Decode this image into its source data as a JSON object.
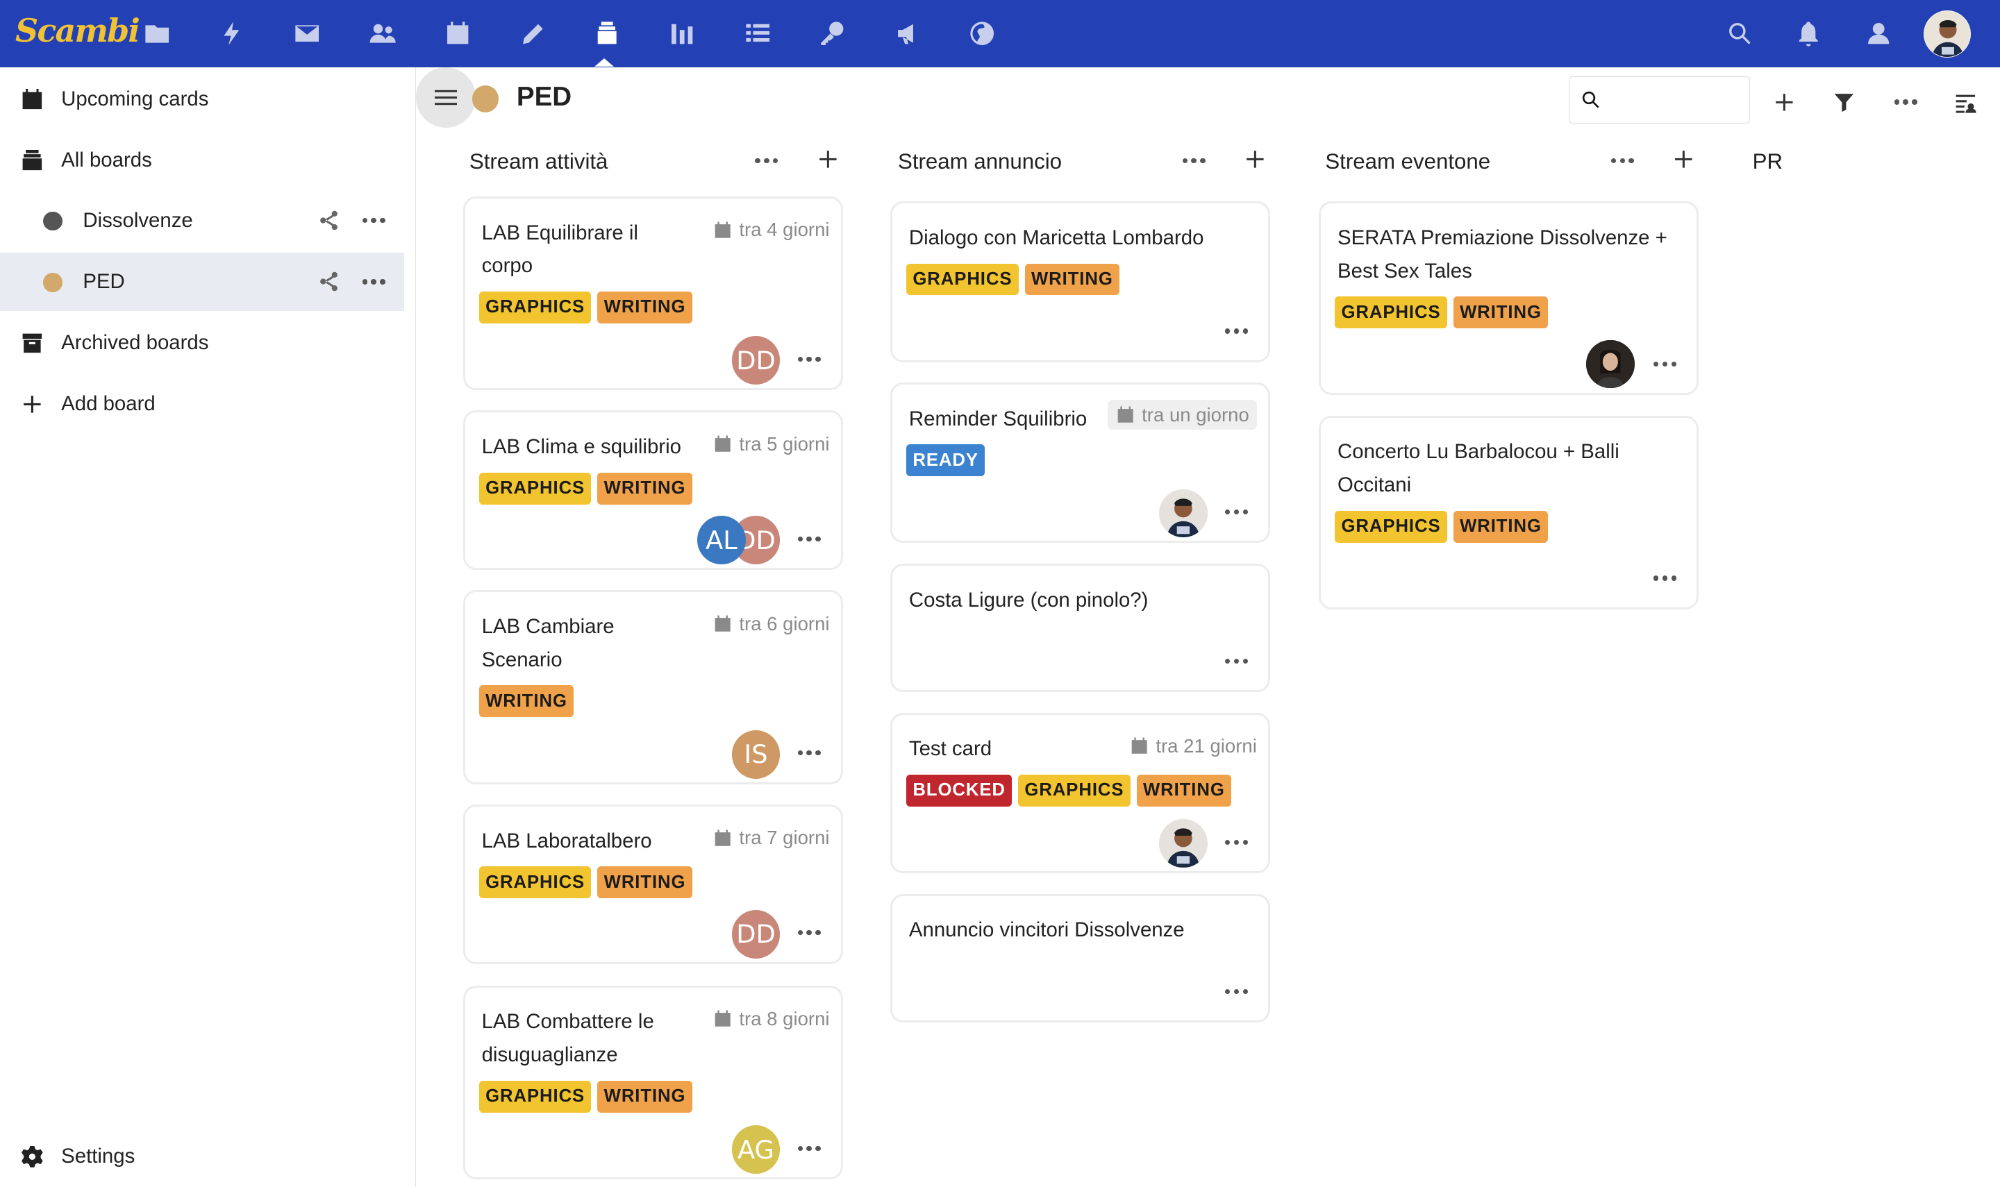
{
  "app": {
    "logo_text": "Scambi",
    "brand_color": "#2340b5"
  },
  "topbar": {
    "apps": [
      "files-icon",
      "activity-icon",
      "mail-icon",
      "contacts-icon",
      "calendar-icon",
      "notes-icon",
      "deck-icon",
      "analytics-icon",
      "tasks-icon",
      "passwords-icon",
      "announcements-icon",
      "globe-icon"
    ],
    "active_app": "deck-icon"
  },
  "sidebar": {
    "upcoming": "Upcoming cards",
    "all_boards": "All boards",
    "boards": [
      {
        "label": "Dissolvenze",
        "color": "#555555"
      },
      {
        "label": "PED",
        "color": "#d3a96b"
      }
    ],
    "archived": "Archived boards",
    "add_board": "Add board",
    "settings": "Settings"
  },
  "board": {
    "title": "PED",
    "color": "#d3a96b",
    "search_placeholder": ""
  },
  "stacks": [
    {
      "title": "Stream attività",
      "cards": [
        {
          "title": "LAB Equilibrare il corpo",
          "due": "tra 4 giorni",
          "labels": [
            "GRAPHICS",
            "WRITING"
          ],
          "assignees": [
            "DD"
          ]
        },
        {
          "title": "LAB Clima e squilibrio",
          "due": "tra 5 giorni",
          "labels": [
            "GRAPHICS",
            "WRITING"
          ],
          "assignees": [
            "AL",
            "DD"
          ]
        },
        {
          "title": "LAB Cambiare Scenario",
          "due": "tra 6 giorni",
          "labels": [
            "WRITING"
          ],
          "assignees": [
            "IS"
          ]
        },
        {
          "title": "LAB Laboratalbero",
          "due": "tra 7 giorni",
          "labels": [
            "GRAPHICS",
            "WRITING"
          ],
          "assignees": [
            "DD"
          ]
        },
        {
          "title": "LAB Combattere le disuguaglianze",
          "due": "tra 8 giorni",
          "labels": [
            "GRAPHICS",
            "WRITING"
          ],
          "assignees": [
            "AG"
          ]
        }
      ]
    },
    {
      "title": "Stream annuncio",
      "cards": [
        {
          "title": "Dialogo con Maricetta Lombardo",
          "labels": [
            "GRAPHICS",
            "WRITING"
          ]
        },
        {
          "title": "Reminder Squilibrio",
          "due": "tra un giorno",
          "labels": [
            "READY"
          ]
        },
        {
          "title": "Costa Ligure (con pinolo?)"
        },
        {
          "title": "Test card",
          "due": "tra 21 giorni",
          "labels": [
            "BLOCKED",
            "GRAPHICS",
            "WRITING"
          ]
        },
        {
          "title": "Annuncio vincitori Dissolvenze"
        }
      ]
    },
    {
      "title": "Stream eventone",
      "cards": [
        {
          "title": "SERATA Premiazione Dissolvenze + Best Sex Tales",
          "labels": [
            "GRAPHICS",
            "WRITING"
          ]
        },
        {
          "title": "Concerto Lu Barbalocou + Balli Occitani",
          "labels": [
            "GRAPHICS",
            "WRITING"
          ]
        }
      ]
    },
    {
      "title": "PR"
    }
  ],
  "avatar_colors": {
    "DD": "#c9877a",
    "AL": "#3a78c2",
    "IS": "#cf9965",
    "AG": "#d6c24e"
  },
  "label_colors": {
    "GRAPHICS": "#f2c42f",
    "WRITING": "#f0a24a",
    "READY": "#3b82d0",
    "BLOCKED": "#c0262d"
  }
}
